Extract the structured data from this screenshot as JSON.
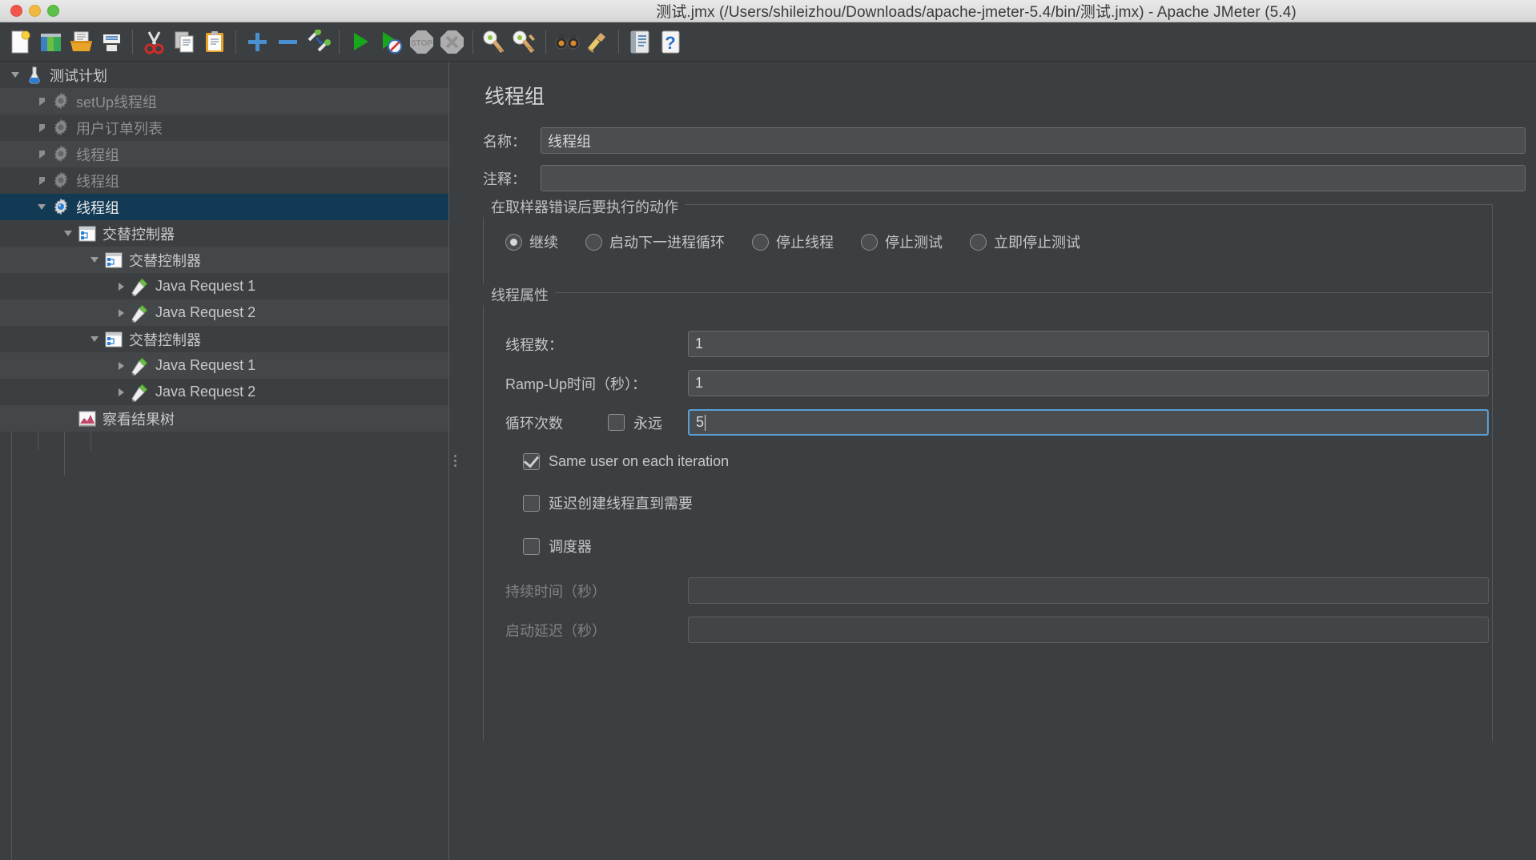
{
  "window": {
    "title": "测试.jmx (/Users/shileizhou/Downloads/apache-jmeter-5.4/bin/测试.jmx) - Apache JMeter (5.4)",
    "traffic_lights": [
      "close",
      "minimize",
      "maximize"
    ]
  },
  "colors": {
    "background": "#3c3f41",
    "row_alt": "#434749",
    "selection": "#133a55",
    "accent_focus": "#5a9fd4",
    "text": "#c8c8c8",
    "text_disabled": "#8e9193"
  },
  "toolbar": {
    "buttons": [
      {
        "name": "new-icon",
        "tooltip": "New"
      },
      {
        "name": "templates-icon",
        "tooltip": "Templates"
      },
      {
        "name": "open-icon",
        "tooltip": "Open"
      },
      {
        "name": "save-icon",
        "tooltip": "Save"
      },
      {
        "name": "cut-icon",
        "tooltip": "Cut"
      },
      {
        "name": "copy-icon",
        "tooltip": "Copy"
      },
      {
        "name": "paste-icon",
        "tooltip": "Paste"
      },
      {
        "name": "expand-all-icon",
        "tooltip": "Expand All"
      },
      {
        "name": "collapse-all-icon",
        "tooltip": "Collapse All"
      },
      {
        "name": "toggle-icon",
        "tooltip": "Toggle"
      },
      {
        "name": "start-icon",
        "tooltip": "Start"
      },
      {
        "name": "start-no-pauses-icon",
        "tooltip": "Start no pauses"
      },
      {
        "name": "stop-icon",
        "tooltip": "Stop"
      },
      {
        "name": "shutdown-icon",
        "tooltip": "Shutdown"
      },
      {
        "name": "clear-icon",
        "tooltip": "Clear"
      },
      {
        "name": "clear-all-icon",
        "tooltip": "Clear All"
      },
      {
        "name": "search-icon",
        "tooltip": "Search"
      },
      {
        "name": "reset-search-icon",
        "tooltip": "Reset Search"
      },
      {
        "name": "function-helper-icon",
        "tooltip": "Function Helper Dialog"
      },
      {
        "name": "help-icon",
        "tooltip": "Help"
      }
    ]
  },
  "tree": {
    "nodes": [
      {
        "label": "测试计划",
        "icon": "test-plan-icon",
        "depth": 0,
        "toggle": "down",
        "state": "normal"
      },
      {
        "label": "setUp线程组",
        "icon": "thread-group-icon",
        "depth": 1,
        "toggle": "right",
        "state": "disabled"
      },
      {
        "label": "用户订单列表",
        "icon": "thread-group-icon",
        "depth": 1,
        "toggle": "right",
        "state": "disabled"
      },
      {
        "label": "线程组",
        "icon": "thread-group-icon",
        "depth": 1,
        "toggle": "right",
        "state": "disabled"
      },
      {
        "label": "线程组",
        "icon": "thread-group-icon",
        "depth": 1,
        "toggle": "right",
        "state": "disabled"
      },
      {
        "label": "线程组",
        "icon": "thread-group-icon-enabled",
        "depth": 1,
        "toggle": "down",
        "state": "selected"
      },
      {
        "label": "交替控制器",
        "icon": "controller-icon",
        "depth": 2,
        "toggle": "down",
        "state": "normal"
      },
      {
        "label": "交替控制器",
        "icon": "controller-icon",
        "depth": 3,
        "toggle": "down",
        "state": "normal"
      },
      {
        "label": "Java Request 1",
        "icon": "java-request-icon",
        "depth": 4,
        "toggle": "right",
        "state": "normal"
      },
      {
        "label": "Java Request 2",
        "icon": "java-request-icon",
        "depth": 4,
        "toggle": "right",
        "state": "normal"
      },
      {
        "label": "交替控制器",
        "icon": "controller-icon",
        "depth": 3,
        "toggle": "down",
        "state": "normal"
      },
      {
        "label": "Java Request 1",
        "icon": "java-request-icon",
        "depth": 4,
        "toggle": "right",
        "state": "normal"
      },
      {
        "label": "Java Request 2",
        "icon": "java-request-icon",
        "depth": 4,
        "toggle": "right",
        "state": "normal"
      },
      {
        "label": "察看结果树",
        "icon": "view-results-tree-icon",
        "depth": 2,
        "toggle": "none",
        "state": "normal"
      }
    ]
  },
  "panel": {
    "title": "线程组",
    "name_label": "名称：",
    "name_value": "线程组",
    "comment_label": "注释：",
    "comment_value": "",
    "comment_placeholder": "",
    "error_action": {
      "group_title": "在取样器错误后要执行的动作",
      "options": [
        {
          "label": "继续",
          "selected": true
        },
        {
          "label": "启动下一进程循环",
          "selected": false
        },
        {
          "label": "停止线程",
          "selected": false
        },
        {
          "label": "停止测试",
          "selected": false
        },
        {
          "label": "立即停止测试",
          "selected": false
        }
      ]
    },
    "thread_properties": {
      "group_title": "线程属性",
      "num_threads_label": "线程数：",
      "num_threads_value": "1",
      "ramp_up_label": "Ramp-Up时间（秒）：",
      "ramp_up_value": "1",
      "loop_count_label": "循环次数",
      "forever_label": "永远",
      "forever_checked": false,
      "loop_count_value": "5",
      "loop_count_focused": true,
      "same_user_label": "Same user on each iteration",
      "same_user_checked": true,
      "delay_creation_label": "延迟创建线程直到需要",
      "delay_creation_checked": false,
      "scheduler_label": "调度器",
      "scheduler_checked": false,
      "duration_label": "持续时间（秒）",
      "duration_value": "",
      "duration_enabled": false,
      "startup_delay_label": "启动延迟（秒）",
      "startup_delay_value": "",
      "startup_delay_enabled": false
    }
  }
}
